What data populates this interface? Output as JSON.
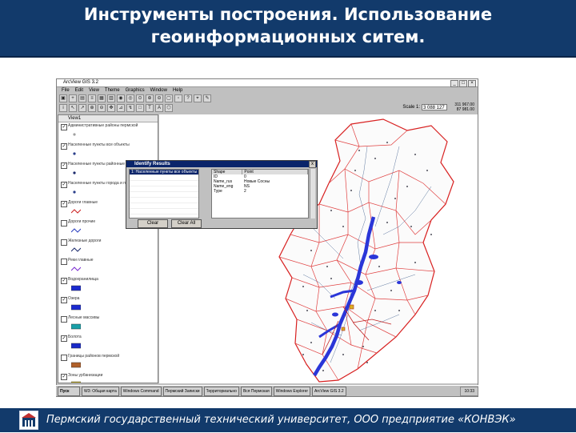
{
  "slide": {
    "title_line1": "Инструменты построения. Использование",
    "title_line2": "геоинформационных ситем.",
    "footer": "Пермский государственный технический университет, ООО предприятие «КОНВЭК»"
  },
  "app": {
    "window_title": "ArcView GIS 3.2",
    "menu": [
      "File",
      "Edit",
      "View",
      "Theme",
      "Graphics",
      "Window",
      "Help"
    ],
    "scale_label": "Scale 1:",
    "scale_value": "3 088 127",
    "coords": [
      "311 967.00",
      "87 981.00"
    ],
    "toc_title": "View1",
    "layers": [
      {
        "name": "Административные районы пермской",
        "checked": true,
        "color": "#a0a0a0"
      },
      {
        "name": "Населенные пункты все объекты",
        "checked": true,
        "color": "#2a3e8a"
      },
      {
        "name": "Населенные пункты районные центры",
        "checked": true,
        "color": "#1b2a6c"
      },
      {
        "name": "Населенные пункты города и поселки",
        "checked": true,
        "color": "#2a3e8a"
      },
      {
        "name": "Дороги главные",
        "checked": true,
        "color": "#cc2020"
      },
      {
        "name": "Дороги прочие",
        "checked": false,
        "color": "#2a3ec0"
      },
      {
        "name": "Железные дороги",
        "checked": false,
        "color": "#1b2a6c"
      },
      {
        "name": "Реки главные",
        "checked": false,
        "color": "#7a2ad0"
      },
      {
        "name": "Водохранилища",
        "checked": true,
        "color": "#1b2ad0"
      },
      {
        "name": "Озера",
        "checked": true,
        "color": "#1b2ad0"
      },
      {
        "name": "Лесные массивы",
        "checked": false,
        "color": "#19a0a8"
      },
      {
        "name": "Болота",
        "checked": true,
        "color": "#1a2ac8"
      },
      {
        "name": "Границы районов пермской",
        "checked": false,
        "color": "#b0602a"
      },
      {
        "name": "Зоны урбанизации",
        "checked": true,
        "color": "#d8c020"
      }
    ],
    "identify": {
      "title": "Identify Results",
      "close_btn": "x",
      "list": [
        "1: Населенные пункты все объекты",
        "",
        "",
        "",
        "",
        "",
        "",
        ""
      ],
      "table_headers": [
        "Shape",
        "Point"
      ],
      "table_rows": [
        [
          "ID",
          "0"
        ],
        [
          "Name_rus",
          "Новые Сосны"
        ],
        [
          "Name_eng",
          "NS"
        ],
        [
          "Type",
          "2"
        ]
      ],
      "btn_clear": "Clear",
      "btn_clear_all": "Clear All"
    },
    "taskbar": {
      "start": "Пуск",
      "items": [
        "W3: Общая карта",
        "Windows Command",
        "Пермский Записки",
        "Территориально",
        "Вся Пермская",
        "Windows Explorer",
        "ArcView GIS 3.2"
      ],
      "tray_time": "10:33"
    }
  }
}
